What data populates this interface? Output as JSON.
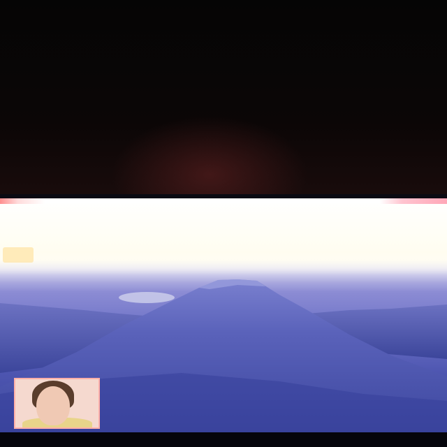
{
  "scene": {
    "description_colors": {
      "sky_glare": "#fffdf6",
      "mountain": "#5860b8",
      "distant_ridge": "#3f49a0",
      "lake": "#c9cbe8",
      "frame": "#0a0a12"
    }
  },
  "overlay": {
    "ticker_text": "",
    "badge_text": "",
    "info_text": ""
  },
  "pip": {
    "subject": "presenter-thumbnail"
  }
}
